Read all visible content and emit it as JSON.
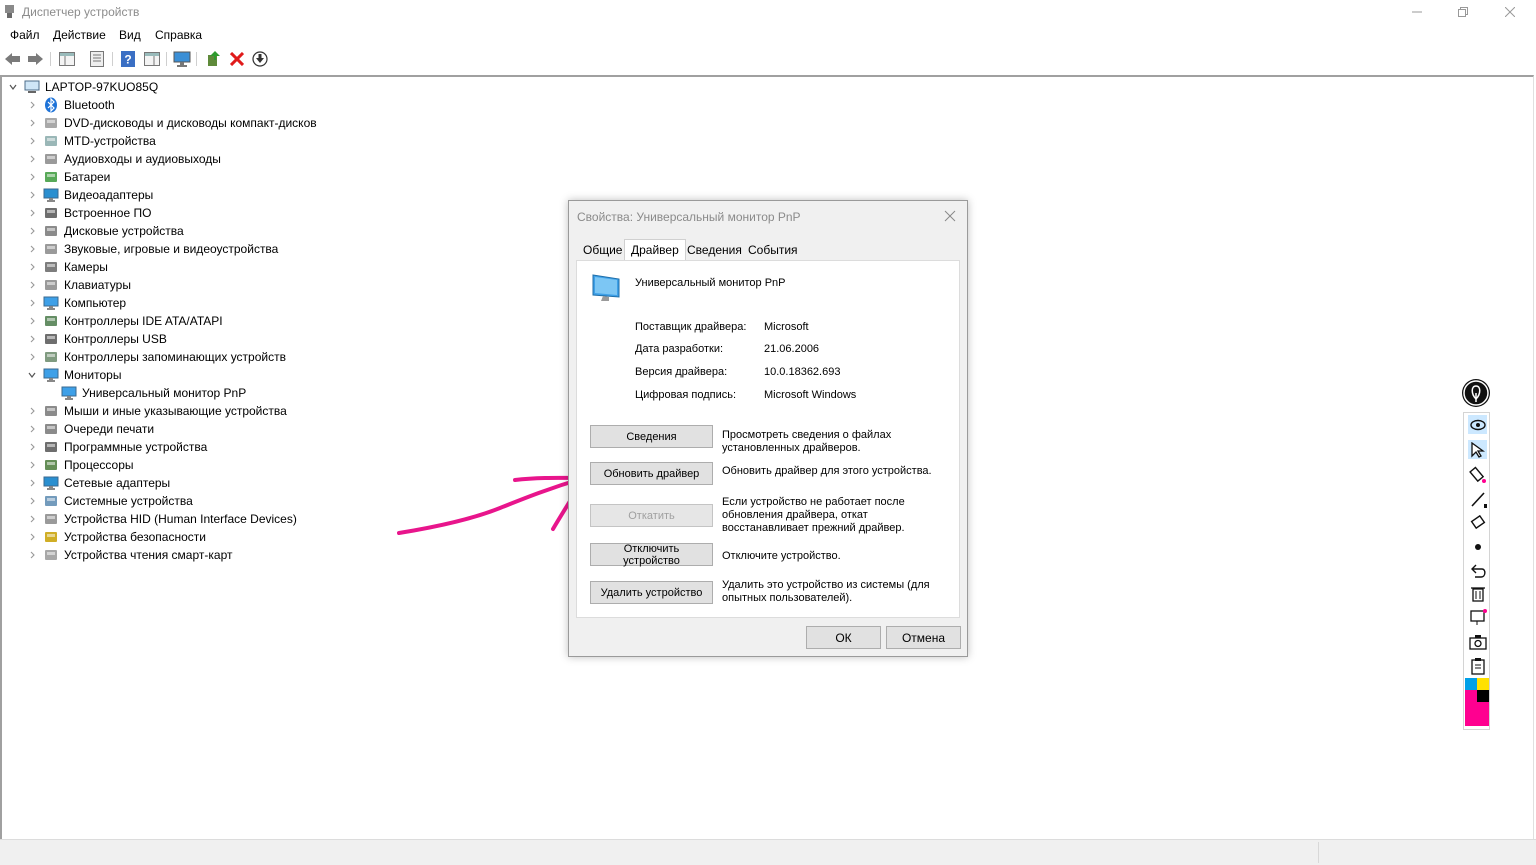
{
  "window": {
    "title": "Диспетчер устройств"
  },
  "menu": [
    "Файл",
    "Действие",
    "Вид",
    "Справка"
  ],
  "toolbar": {
    "icons": [
      "back-arrow-icon",
      "forward-arrow-icon",
      "show-hide-console-tree-icon",
      "properties-icon",
      "help-icon",
      "action-pane-icon",
      "monitor-scan-icon",
      "update-driver-icon",
      "uninstall-icon",
      "download-icon"
    ]
  },
  "tree": {
    "root": "LAPTOP-97KUO85Q",
    "items": [
      {
        "label": "Bluetooth",
        "icon": "bluetooth-icon"
      },
      {
        "label": "DVD-дисководы и дисководы компакт-дисков",
        "icon": "dvd-drive-icon"
      },
      {
        "label": "MTD-устройства",
        "icon": "mtd-device-icon"
      },
      {
        "label": "Аудиовходы и аудиовыходы",
        "icon": "speaker-icon"
      },
      {
        "label": "Батареи",
        "icon": "battery-icon"
      },
      {
        "label": "Видеоадаптеры",
        "icon": "display-adapter-icon"
      },
      {
        "label": "Встроенное ПО",
        "icon": "firmware-icon"
      },
      {
        "label": "Дисковые устройства",
        "icon": "disk-drive-icon"
      },
      {
        "label": "Звуковые, игровые и видеоустройства",
        "icon": "sound-icon"
      },
      {
        "label": "Камеры",
        "icon": "camera-icon"
      },
      {
        "label": "Клавиатуры",
        "icon": "keyboard-icon"
      },
      {
        "label": "Компьютер",
        "icon": "computer-icon"
      },
      {
        "label": "Контроллеры IDE ATA/ATAPI",
        "icon": "ide-controller-icon"
      },
      {
        "label": "Контроллеры USB",
        "icon": "usb-icon"
      },
      {
        "label": "Контроллеры запоминающих устройств",
        "icon": "storage-controller-icon"
      },
      {
        "label": "Мониторы",
        "icon": "monitor-icon",
        "expanded": true
      },
      {
        "label": "Универсальный монитор PnP",
        "icon": "monitor-icon",
        "child": true
      },
      {
        "label": "Мыши и иные указывающие устройства",
        "icon": "mouse-icon"
      },
      {
        "label": "Очереди печати",
        "icon": "printer-icon"
      },
      {
        "label": "Программные устройства",
        "icon": "software-device-icon"
      },
      {
        "label": "Процессоры",
        "icon": "processor-icon"
      },
      {
        "label": "Сетевые адаптеры",
        "icon": "network-adapter-icon"
      },
      {
        "label": "Системные устройства",
        "icon": "system-device-icon"
      },
      {
        "label": "Устройства HID (Human Interface Devices)",
        "icon": "hid-icon"
      },
      {
        "label": "Устройства безопасности",
        "icon": "security-device-icon"
      },
      {
        "label": "Устройства чтения смарт-карт",
        "icon": "smart-card-icon"
      }
    ]
  },
  "dialog": {
    "title": "Свойства: Универсальный монитор PnP",
    "tabs": [
      "Общие",
      "Драйвер",
      "Сведения",
      "События"
    ],
    "active_tab": "Драйвер",
    "device_name": "Универсальный монитор PnP",
    "fields": [
      {
        "label": "Поставщик драйвера:",
        "value": "Microsoft"
      },
      {
        "label": "Дата разработки:",
        "value": "21.06.2006"
      },
      {
        "label": "Версия драйвера:",
        "value": "10.0.18362.693"
      },
      {
        "label": "Цифровая подпись:",
        "value": "Microsoft Windows"
      }
    ],
    "buttons": [
      {
        "label": "Сведения",
        "desc": "Просмотреть сведения о файлах установленных драйверов.",
        "enabled": true
      },
      {
        "label": "Обновить драйвер",
        "desc": "Обновить драйвер для этого устройства.",
        "enabled": true
      },
      {
        "label": "Откатить",
        "desc": "Если устройство не работает после обновления драйвера, откат восстанавливает прежний драйвер.",
        "enabled": false
      },
      {
        "label": "Отключить устройство",
        "desc": "Отключите устройство.",
        "enabled": true
      },
      {
        "label": "Удалить устройство",
        "desc": "Удалить это устройство из системы (для опытных пользователей).",
        "enabled": true
      }
    ],
    "ok_label": "ОК",
    "cancel_label": "Отмена"
  },
  "annotation_toolbar": {
    "tools": [
      "eye-icon",
      "cursor-icon",
      "highlighter-icon",
      "pen-icon",
      "eraser-icon",
      "dot-size-icon",
      "undo-icon",
      "trash-icon",
      "whiteboard-icon",
      "camera-snap-icon",
      "clipboard-icon"
    ],
    "palette": [
      "#00a0e8",
      "#ffe100",
      "#ff0090",
      "#000000"
    ]
  },
  "colors": {
    "annotation_stroke": "#e8158c",
    "active_tool": "#cce8ff"
  }
}
